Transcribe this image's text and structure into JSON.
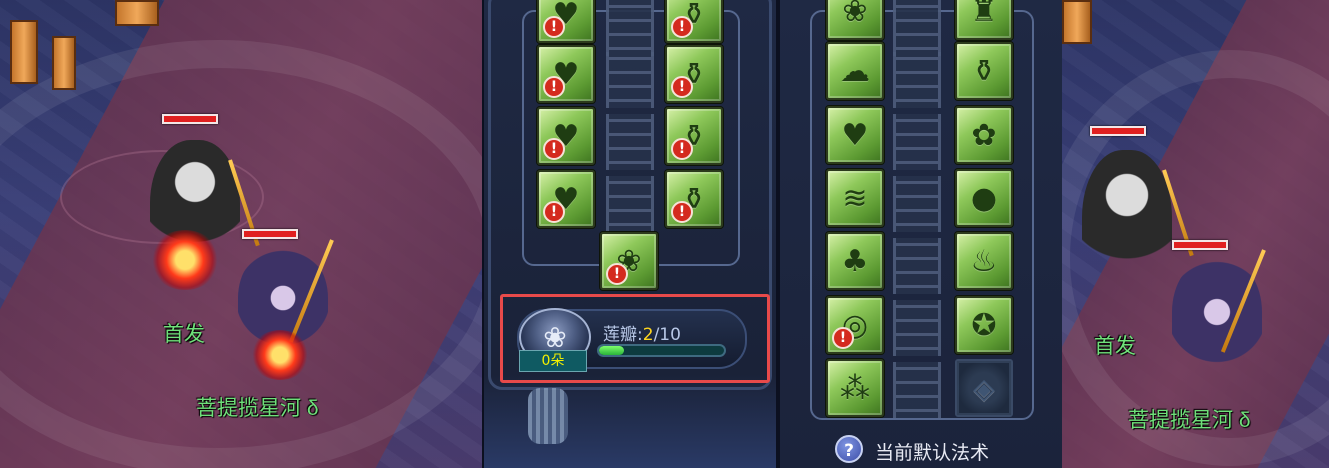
{
  "scene_left": {
    "leader_tag": "首发",
    "follower_tag": "菩提揽星河 δ"
  },
  "scene_right": {
    "leader_tag": "首发",
    "follower_tag": "菩提揽星河 δ"
  },
  "left_panel": {
    "tiles": [
      {
        "id": "l0a",
        "icon": "hearts-rain-icon",
        "glyph": "♥",
        "warning": true
      },
      {
        "id": "l0b",
        "icon": "vase-icon",
        "glyph": "⚱",
        "warning": true
      },
      {
        "id": "l1a",
        "icon": "hearts-rain-icon",
        "glyph": "♥",
        "warning": true
      },
      {
        "id": "l1b",
        "icon": "vase-icon",
        "glyph": "⚱",
        "warning": true
      },
      {
        "id": "l2a",
        "icon": "hearts-rain-icon",
        "glyph": "♥",
        "warning": true
      },
      {
        "id": "l2b",
        "icon": "vase-icon",
        "glyph": "⚱",
        "warning": true
      },
      {
        "id": "l3a",
        "icon": "hearts-rain-icon",
        "glyph": "♥",
        "warning": true
      },
      {
        "id": "l3b",
        "icon": "vase-icon",
        "glyph": "⚱",
        "warning": true
      },
      {
        "id": "l4",
        "icon": "lotus-icon",
        "glyph": "❀",
        "warning": true
      }
    ],
    "warning_glyph": "!",
    "petal": {
      "label": "莲瓣:",
      "current": "2",
      "total": "/10",
      "progress": 0.2,
      "count": "0朵",
      "lotus_glyph": "❀"
    }
  },
  "right_panel": {
    "tiles": [
      {
        "id": "r0a",
        "icon": "lotus-icon",
        "glyph": "❀",
        "warning": false
      },
      {
        "id": "r0b",
        "icon": "tower-icon",
        "glyph": "♜",
        "warning": false
      },
      {
        "id": "r1a",
        "icon": "cloud-face-icon",
        "glyph": "☁",
        "warning": false
      },
      {
        "id": "r1b",
        "icon": "vase-icon",
        "glyph": "⚱",
        "warning": false
      },
      {
        "id": "r2a",
        "icon": "hearts-rain-icon",
        "glyph": "♥",
        "warning": false
      },
      {
        "id": "r2b",
        "icon": "flower-icon",
        "glyph": "✿",
        "warning": false
      },
      {
        "id": "r3a",
        "icon": "water-wave-icon",
        "glyph": "≋",
        "warning": false
      },
      {
        "id": "r3b",
        "icon": "stones-icon",
        "glyph": "●",
        "warning": false
      },
      {
        "id": "r4a",
        "icon": "tree-icon",
        "glyph": "♣",
        "warning": false
      },
      {
        "id": "r4b",
        "icon": "fire-icon",
        "glyph": "♨",
        "warning": false
      },
      {
        "id": "r5a",
        "icon": "circle-seal-icon",
        "glyph": "◎",
        "warning": true
      },
      {
        "id": "r5b",
        "icon": "pentagram-icon",
        "glyph": "✪",
        "warning": false
      },
      {
        "id": "r6a",
        "icon": "rain-grass-icon",
        "glyph": "⁂",
        "warning": false
      },
      {
        "id": "r6b",
        "icon": "empty-slot-icon",
        "glyph": "◈",
        "warning": false,
        "empty": true
      }
    ],
    "warning_glyph": "!",
    "help_glyph": "?",
    "footer_label": "当前默认法术"
  }
}
